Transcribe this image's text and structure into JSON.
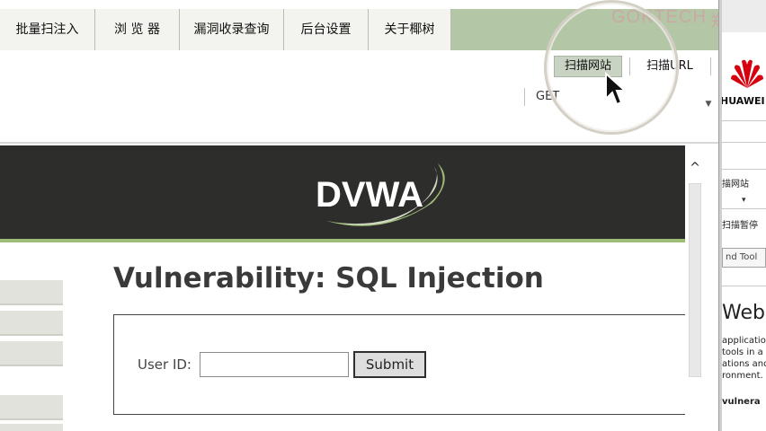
{
  "app": {
    "brand": "GOKTECH",
    "brand_tail": "郑"
  },
  "menu": {
    "items": [
      {
        "id": "batch-import",
        "label": "批量扫注入"
      },
      {
        "id": "browser",
        "label": "浏 览 器"
      },
      {
        "id": "vuln-db",
        "label": "漏洞收录查询"
      },
      {
        "id": "settings",
        "label": "后台设置"
      },
      {
        "id": "about",
        "label": "关于椰树"
      }
    ]
  },
  "toolbar": {
    "scan_site": "扫描网站",
    "scan_url": "扫描URL",
    "method": "GET",
    "dropdown_glyph": "▼"
  },
  "dvwa": {
    "logo_text": "DVWA",
    "page_title": "Vulnerability: SQL Injection",
    "form": {
      "userid_label": "User ID:",
      "userid_value": "",
      "submit_label": "Submit"
    }
  },
  "scrollbar": {
    "up_glyph": "^"
  },
  "side_panel": {
    "brand": "HUAWEI",
    "scan_site": "描网站",
    "dropdown_glyph": "▾",
    "scan_pause": "扫描暂停",
    "tool_button": "nd Tool",
    "heading": "Web A",
    "lines": [
      "applicatio",
      "tools in a",
      "ations and",
      "ronment."
    ],
    "vuln_line": "vulnera"
  },
  "colors": {
    "menu_bg": "#f3f4ef",
    "brand_area": "#b3c7a6",
    "dvwa_header": "#2d2d2b",
    "dvwa_accent": "#9fbc77",
    "scan_site_btn": "#c9d3c3",
    "huawei_red": "#d7000f"
  },
  "icons": {
    "cursor": "arrow-cursor-icon",
    "scroll_up": "chevron-up-icon",
    "huawei": "huawei-logo-icon"
  }
}
